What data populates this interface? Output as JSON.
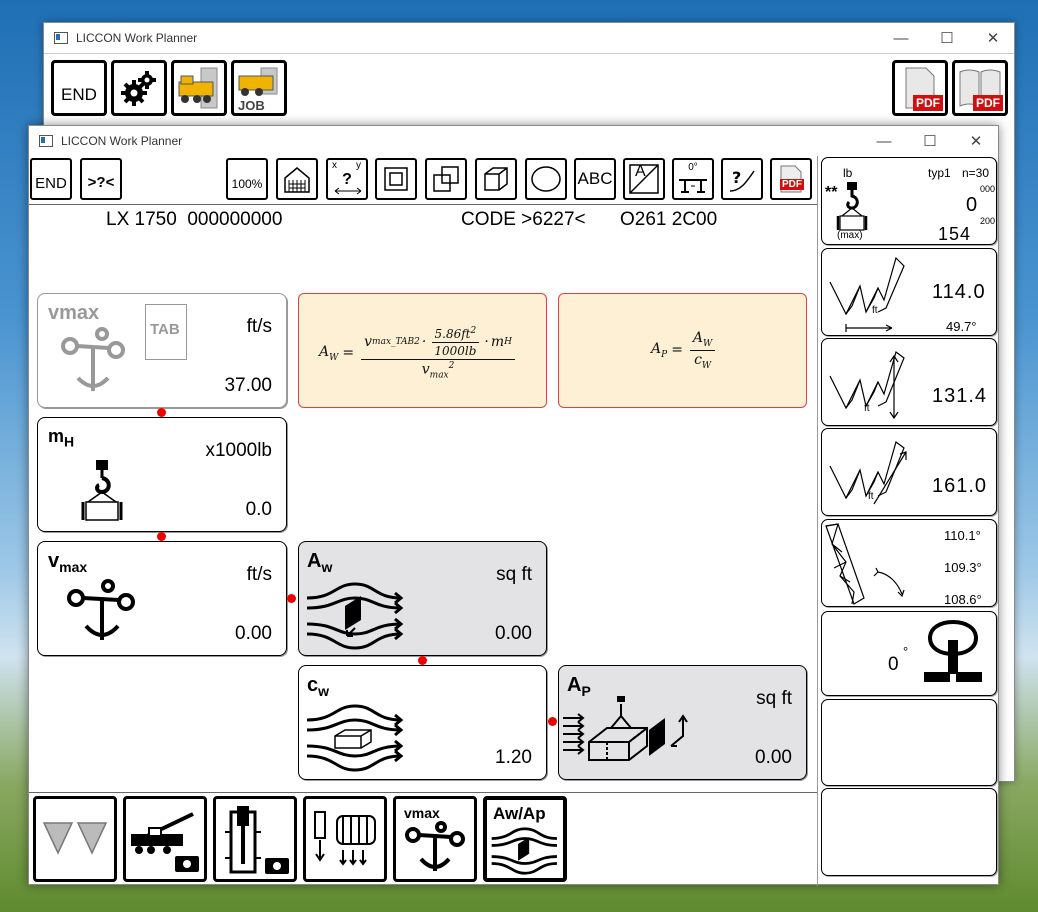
{
  "back_window": {
    "title": "LICCON Work Planner",
    "toolbar": {
      "end_label": "END",
      "job_label": "JOB",
      "pdf_label": "PDF"
    }
  },
  "front_window": {
    "title": "LICCON Work Planner",
    "toolbar": {
      "end_label": "END",
      "search_label": ">?<",
      "zoom_label": "100%",
      "text_label": "ABC",
      "angle_label": "0°",
      "pdf_label": "PDF",
      "axis_x": "x",
      "axis_y": "y",
      "question": "?",
      "no_text_label": "A"
    },
    "info": {
      "crane": "LX 1750  000000000",
      "code": "CODE >6227<",
      "config": "O261 2C00"
    },
    "cards": {
      "vmax_tab": {
        "title": "vmax",
        "tab": "TAB",
        "unit": "ft/s",
        "value": "37.00"
      },
      "formula_aw": {
        "lhs": "A",
        "lhs_sub": "W",
        "num_a": "v",
        "num_a_sub": "max_TAB",
        "num_frac_top": "5.86ft",
        "num_frac_bottom": "1000lb",
        "num_m": "m",
        "num_m_sub": "H",
        "den": "v",
        "den_sub": "max"
      },
      "formula_ap": {
        "lhs": "A",
        "lhs_sub": "P",
        "num": "A",
        "num_sub": "W",
        "den": "c",
        "den_sub": "W"
      },
      "mh": {
        "title": "m",
        "title_sub": "H",
        "unit": "x1000lb",
        "value": "0.0"
      },
      "vmax": {
        "title": "v",
        "title_sub": "max",
        "unit": "ft/s",
        "value": "0.00"
      },
      "aw": {
        "title": "A",
        "title_sub": "w",
        "unit": "sq ft",
        "value": "0.00"
      },
      "cw": {
        "title": "c",
        "title_sub": "w",
        "value": "1.20"
      },
      "ap": {
        "title": "A",
        "title_sub": "P",
        "unit": "sq ft",
        "value": "0.00"
      }
    },
    "right_panel": {
      "load": {
        "unit": "lb",
        "type": "typ1",
        "n": "n=30",
        "stars": "**",
        "v1_small": "000",
        "v1": "0",
        "v2_small": "200",
        "v2": "154",
        "max": "(max)"
      },
      "radius": {
        "value": "114.0",
        "angle": "49.7°",
        "unit": "ft"
      },
      "height": {
        "value": "131.4",
        "unit": "ft"
      },
      "length": {
        "value": "161.0",
        "unit": "ft"
      },
      "angles": {
        "a1": "110.1°",
        "a2": "109.3°",
        "a3": "108.6°"
      },
      "slew": {
        "value": "0",
        "unit": "°"
      }
    },
    "bottom": {
      "aw_ap_label": "Aw/Ap",
      "vmax_label": "vmax"
    }
  },
  "colors": {
    "formula_bg": "#fdf0d4",
    "formula_border": "#e14040",
    "connector_dot": "#e00000",
    "gray_card": "#e3e3e6"
  }
}
